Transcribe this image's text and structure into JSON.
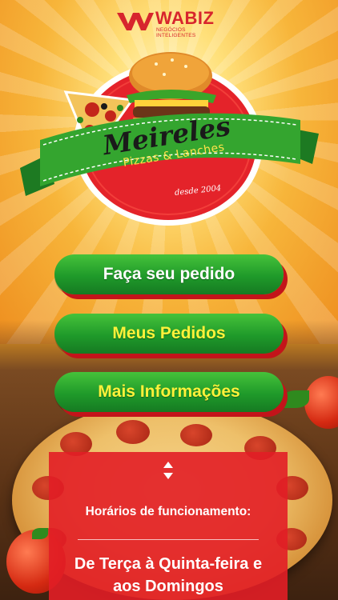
{
  "header": {
    "brand": "WABIZ",
    "tagline": "NEGÓCIOS INTELIGENTES"
  },
  "logo": {
    "name": "Meireles",
    "subtitle": "Pizzas & Lanches",
    "since": "desde 2004"
  },
  "menu": {
    "order_label": "Faça seu pedido",
    "my_orders_label": "Meus Pedidos",
    "more_info_label": "Mais Informações"
  },
  "info": {
    "hours_title": "Horários de funcionamento:",
    "days_line1": "De Terça à Quinta-feira e",
    "days_line2": "aos Domingos"
  },
  "colors": {
    "button_green": "#1f9a2a",
    "button_shadow_red": "#c3141a",
    "panel_red": "#e21e26",
    "label_yellow": "#fff23a",
    "brand_red": "#d7252d"
  },
  "icons": {
    "scroll_arrows": "up-down-arrows-icon"
  }
}
